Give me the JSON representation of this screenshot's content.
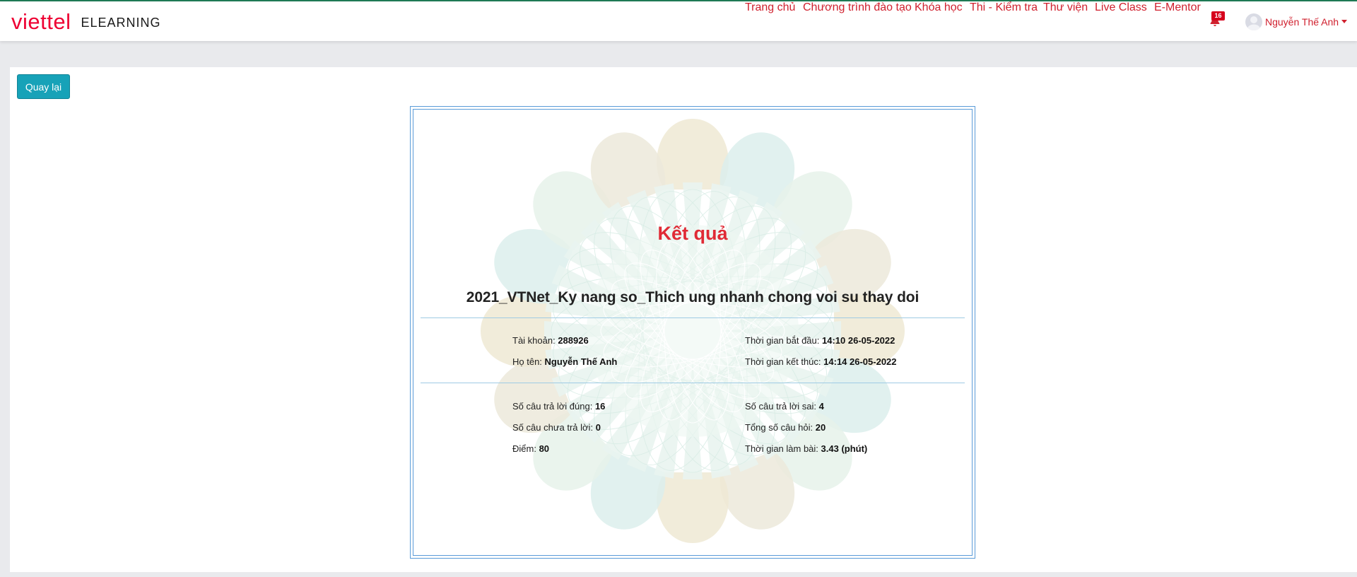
{
  "brand": {
    "logo_text": "viettel",
    "product": "ELEARNING"
  },
  "nav": {
    "items": [
      {
        "label": "Trang chủ"
      },
      {
        "label": "Chương trình đào tạo"
      },
      {
        "label": "Khóa học"
      },
      {
        "label": "Thi - Kiểm tra"
      },
      {
        "label": "Thư viện"
      },
      {
        "label": "Live Class"
      },
      {
        "label": "E-Mentor"
      }
    ],
    "notifications": {
      "icon": "bell-icon",
      "count": "16"
    },
    "user": {
      "name": "Nguyễn Thế Anh",
      "avatar_icon": "user-avatar-icon"
    }
  },
  "page": {
    "back_label": "Quay lại"
  },
  "result": {
    "title": "Kết quả",
    "exam_name": "2021_VTNet_Ky nang so_Thich ung nhanh chong voi su thay doi",
    "account_label": "Tài khoản:",
    "account_value": "288926",
    "name_label": "Họ tên:",
    "name_value": "Nguyễn Thế Anh",
    "start_label": "Thời gian bắt đầu:",
    "start_value": "14:10 26-05-2022",
    "end_label": "Thời gian kết thúc:",
    "end_value": "14:14 26-05-2022",
    "correct_label": "Số câu trả lời đúng:",
    "correct_value": "16",
    "wrong_label": "Số câu trả lời sai:",
    "wrong_value": "4",
    "unanswered_label": "Số câu chưa trả lời:",
    "unanswered_value": "0",
    "total_label": "Tổng số câu hỏi:",
    "total_value": "20",
    "score_label": "Điểm:",
    "score_value": "80",
    "duration_label": "Thời gian làm bài:",
    "duration_value": "3.43 (phút)"
  },
  "colors": {
    "brand_red": "#ee0033",
    "nav_red": "#d0202e",
    "button_teal": "#17a2b8",
    "accent_green": "#1e7a55"
  }
}
